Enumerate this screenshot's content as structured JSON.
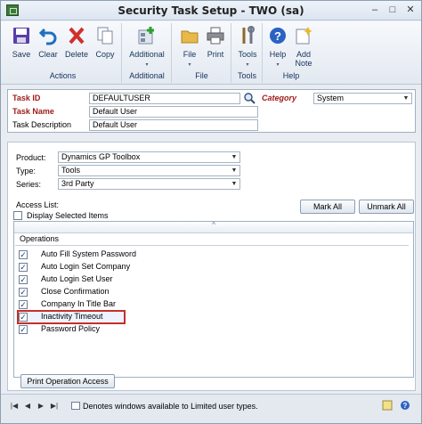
{
  "window": {
    "title": "Security Task Setup  -  TWO (sa)"
  },
  "ribbon": {
    "groups": [
      {
        "label": "Actions",
        "buttons": [
          {
            "label": "Save",
            "icon": "save-icon"
          },
          {
            "label": "Clear",
            "icon": "clear-icon"
          },
          {
            "label": "Delete",
            "icon": "delete-icon"
          },
          {
            "label": "Copy",
            "icon": "copy-icon"
          }
        ]
      },
      {
        "label": "Additional",
        "buttons": [
          {
            "label": "Additional",
            "icon": "additional-icon",
            "dropdown": "▾"
          }
        ]
      },
      {
        "label": "File",
        "buttons": [
          {
            "label": "File",
            "icon": "folder-icon",
            "dropdown": "▾"
          },
          {
            "label": "Print",
            "icon": "printer-icon"
          }
        ]
      },
      {
        "label": "Tools",
        "buttons": [
          {
            "label": "Tools",
            "icon": "tools-icon",
            "dropdown": "▾"
          }
        ]
      },
      {
        "label": "Help",
        "buttons": [
          {
            "label": "Help",
            "icon": "help-icon",
            "dropdown": "▾"
          },
          {
            "label": "Add Note",
            "line1": "Add",
            "line2": "Note",
            "icon": "add-note-icon"
          }
        ]
      }
    ]
  },
  "header": {
    "task_id_label": "Task ID",
    "task_id_value": "DEFAULTUSER",
    "task_name_label": "Task Name",
    "task_name_value": "Default User",
    "task_desc_label": "Task Description",
    "task_desc_value": "Default User",
    "category_label": "Category",
    "category_value": "System"
  },
  "filters": {
    "product_label": "Product:",
    "product_value": "Dynamics GP Toolbox",
    "type_label": "Type:",
    "type_value": "Tools",
    "series_label": "Series:",
    "series_value": "3rd Party"
  },
  "access": {
    "access_list_label": "Access List:",
    "display_selected_label": "Display Selected Items",
    "mark_all_label": "Mark All",
    "unmark_all_label": "Unmark All",
    "operations_header": "Operations",
    "sort_caret": "^",
    "operations": [
      {
        "name": "Auto Fill System Password",
        "checked": "✓"
      },
      {
        "name": "Auto Login Set Company",
        "checked": "✓"
      },
      {
        "name": "Auto Login Set User",
        "checked": "✓"
      },
      {
        "name": "Close Confirmation",
        "checked": "✓"
      },
      {
        "name": "Company In Title Bar",
        "checked": "✓"
      },
      {
        "name": "Inactivity Timeout",
        "checked": "✓"
      },
      {
        "name": "Password Policy",
        "checked": "✓"
      }
    ],
    "print_button_label": "Print Operation Access"
  },
  "footer": {
    "nav": [
      "|◀",
      "◀",
      "▶",
      "▶|"
    ],
    "note": "Denotes windows available to Limited user types."
  },
  "colors": {
    "required": "#9e1a1a",
    "highlight_border": "#c4302b",
    "ribbon_text": "#15325c"
  }
}
